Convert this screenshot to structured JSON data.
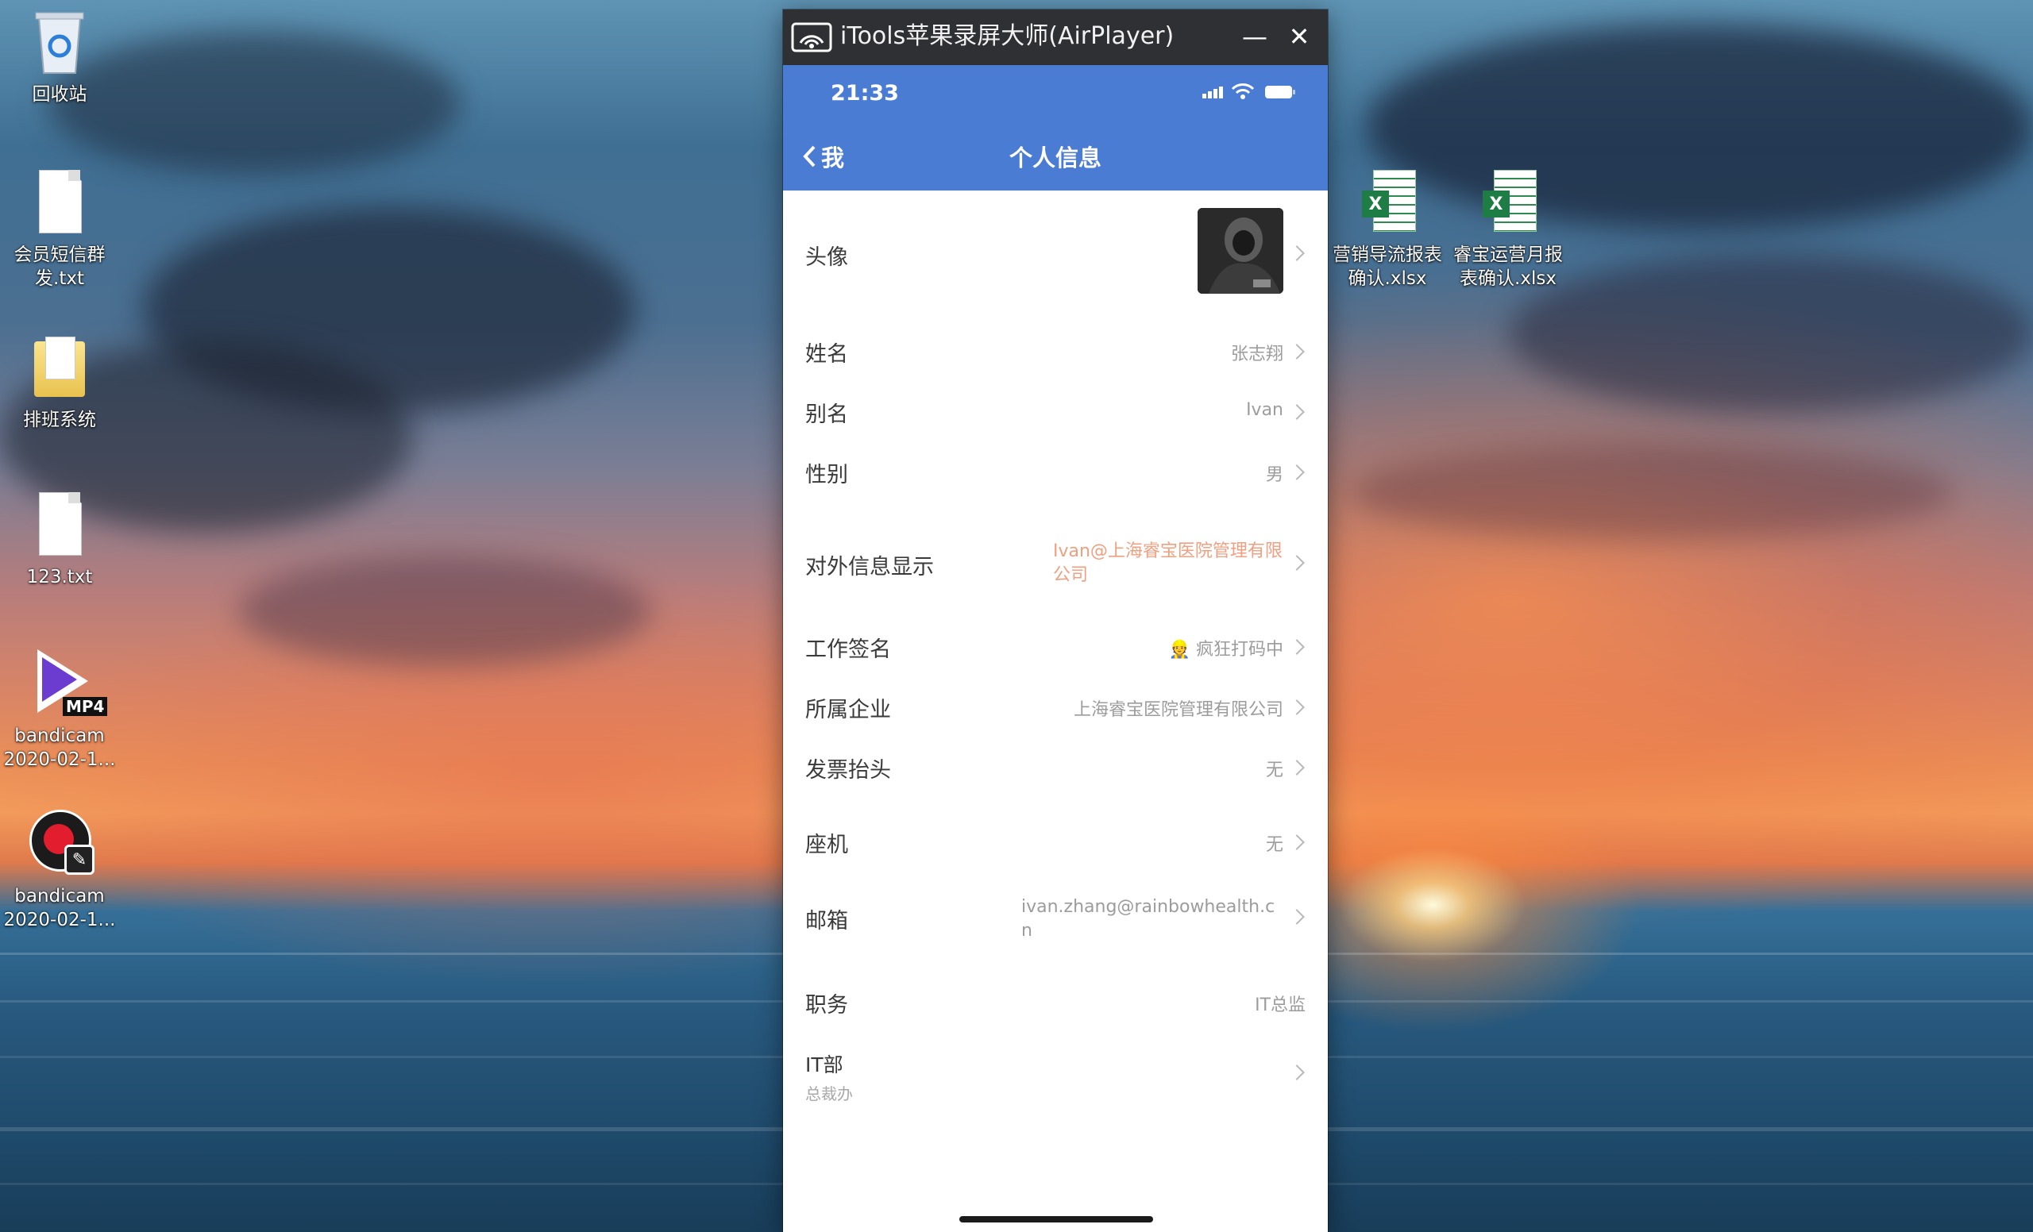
{
  "desktop": {
    "icons": [
      {
        "label": "回收站",
        "icon": "recycle-bin-icon"
      },
      {
        "label": "会员短信群\n发.txt",
        "icon": "text-file-icon"
      },
      {
        "label": "排班系统",
        "icon": "folder-icon"
      },
      {
        "label": "123.txt",
        "icon": "text-file-icon"
      },
      {
        "label": "bandicam\n2020-02-1...",
        "icon": "mp4-video-icon",
        "badge": "MP4"
      },
      {
        "label": "bandicam\n2020-02-1...",
        "icon": "bandicam-icon"
      },
      {
        "label": "营销导流报表\n确认.xlsx",
        "icon": "excel-file-icon",
        "badge": "X"
      },
      {
        "label": "睿宝运营月报\n表确认.xlsx",
        "icon": "excel-file-icon",
        "badge": "X"
      }
    ]
  },
  "window": {
    "title": "iTools苹果录屏大师(AirPlayer)",
    "minimize_glyph": "—",
    "close_glyph": "✕"
  },
  "phone": {
    "status_time": "21:33",
    "nav": {
      "back_label": "我",
      "title": "个人信息"
    },
    "rows": [
      {
        "label": "头像",
        "value": ""
      },
      {
        "label": "姓名",
        "value": "张志翔"
      },
      {
        "label": "别名",
        "value": "Ivan"
      },
      {
        "label": "性别",
        "value": "男"
      },
      {
        "label": "对外信息显示",
        "value": "Ivan@上海睿宝医院管理有限公司"
      },
      {
        "label": "工作签名",
        "value": "👷 疯狂打码中"
      },
      {
        "label": "所属企业",
        "value": "上海睿宝医院管理有限公司"
      },
      {
        "label": "发票抬头",
        "value": "无"
      },
      {
        "label": "座机",
        "value": "无"
      },
      {
        "label": "邮箱",
        "value": "ivan.zhang@rainbowhealth.cn"
      },
      {
        "label": "职务",
        "value": "IT总监"
      },
      {
        "label": "IT部",
        "sublabel": "总裁办",
        "value": ""
      }
    ],
    "colors": {
      "nav_blue": "#4a7cd3",
      "external_info_orange": "#f0a080"
    }
  }
}
